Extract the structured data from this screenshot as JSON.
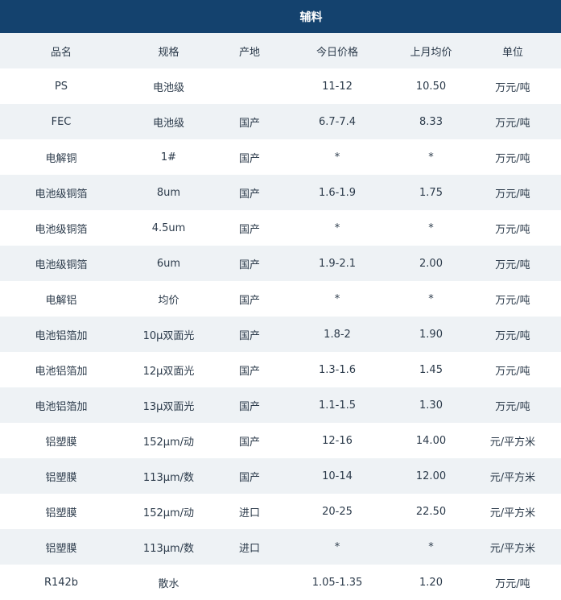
{
  "title": "辅料",
  "headers": [
    "品名",
    "规格",
    "产地",
    "今日价格",
    "上月均价",
    "单位"
  ],
  "rows": [
    {
      "name": "PS",
      "spec": "电池级",
      "origin": "",
      "today": "11-12",
      "last_month": "10.50",
      "unit": "万元/吨"
    },
    {
      "name": "FEC",
      "spec": "电池级",
      "origin": "国产",
      "today": "6.7-7.4",
      "last_month": "8.33",
      "unit": "万元/吨"
    },
    {
      "name": "电解铜",
      "spec": "1#",
      "origin": "国产",
      "today": "*",
      "last_month": "*",
      "unit": "万元/吨"
    },
    {
      "name": "电池级铜箔",
      "spec": "8um",
      "origin": "国产",
      "today": "1.6-1.9",
      "last_month": "1.75",
      "unit": "万元/吨"
    },
    {
      "name": "电池级铜箔",
      "spec": "4.5um",
      "origin": "国产",
      "today": "*",
      "last_month": "*",
      "unit": "万元/吨"
    },
    {
      "name": "电池级铜箔",
      "spec": "6um",
      "origin": "国产",
      "today": "1.9-2.1",
      "last_month": "2.00",
      "unit": "万元/吨"
    },
    {
      "name": "电解铝",
      "spec": "均价",
      "origin": "国产",
      "today": "*",
      "last_month": "*",
      "unit": "万元/吨"
    },
    {
      "name": "电池铝箔加",
      "spec": "10μ双面光",
      "origin": "国产",
      "today": "1.8-2",
      "last_month": "1.90",
      "unit": "万元/吨"
    },
    {
      "name": "电池铝箔加",
      "spec": "12μ双面光",
      "origin": "国产",
      "today": "1.3-1.6",
      "last_month": "1.45",
      "unit": "万元/吨"
    },
    {
      "name": "电池铝箔加",
      "spec": "13μ双面光",
      "origin": "国产",
      "today": "1.1-1.5",
      "last_month": "1.30",
      "unit": "万元/吨"
    },
    {
      "name": "铝塑膜",
      "spec": "152μm/动",
      "origin": "国产",
      "today": "12-16",
      "last_month": "14.00",
      "unit": "元/平方米"
    },
    {
      "name": "铝塑膜",
      "spec": "113μm/数",
      "origin": "国产",
      "today": "10-14",
      "last_month": "12.00",
      "unit": "元/平方米"
    },
    {
      "name": "铝塑膜",
      "spec": "152μm/动",
      "origin": "进口",
      "today": "20-25",
      "last_month": "22.50",
      "unit": "元/平方米"
    },
    {
      "name": "铝塑膜",
      "spec": "113μm/数",
      "origin": "进口",
      "today": "*",
      "last_month": "*",
      "unit": "元/平方米"
    },
    {
      "name": "R142b",
      "spec": "散水",
      "origin": "",
      "today": "1.05-1.35",
      "last_month": "1.20",
      "unit": "万元/吨"
    }
  ]
}
